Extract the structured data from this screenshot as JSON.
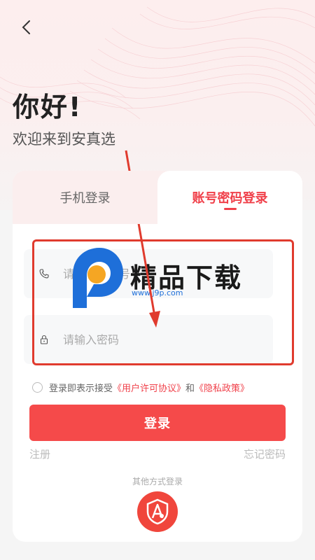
{
  "header": {
    "greeting": "你好!",
    "welcome": "欢迎来到安真选"
  },
  "tabs": [
    {
      "label": "手机登录",
      "active": false
    },
    {
      "label": "账号密码登录",
      "active": true
    }
  ],
  "form": {
    "phone_placeholder": "请输入手机号",
    "password_placeholder": "请输入密码"
  },
  "agreement": {
    "prefix": "登录即表示接受",
    "user_agreement": "《用户许可协议》",
    "and": "和",
    "privacy_policy": "《隐私政策》",
    "checked": false
  },
  "login_button": "登录",
  "register_link": "注册",
  "forgot_link": "忘记密码",
  "other_methods_label": "其他方式登录",
  "watermark": {
    "brand": "精品下载",
    "url": "www.j9p.com"
  },
  "colors": {
    "accent": "#f0404a",
    "button": "#f54a4a",
    "annotation": "#e03b2e"
  }
}
